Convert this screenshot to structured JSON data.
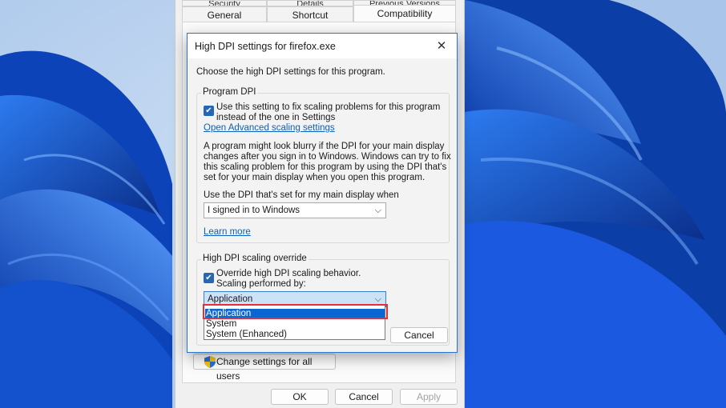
{
  "properties": {
    "tabs_top": [
      "Security",
      "Details",
      "Previous Versions"
    ],
    "tabs": [
      "General",
      "Shortcut",
      "Compatibility"
    ],
    "active_tab": "Compatibility",
    "change_settings_label": "Change settings for all users",
    "ok_label": "OK",
    "cancel_label": "Cancel",
    "apply_label": "Apply"
  },
  "dpi_dialog": {
    "title": "High DPI settings for firefox.exe",
    "intro": "Choose the high DPI settings for this program.",
    "program_dpi": {
      "group_label": "Program DPI",
      "checkbox_checked": true,
      "checkbox_line1": "Use this setting to fix scaling problems for this program",
      "checkbox_line2": "instead of the one in Settings",
      "link_advanced": "Open Advanced scaling settings",
      "description_lines": [
        "A program might look blurry if the DPI for your main display",
        "changes after you sign in to Windows. Windows can try to fix",
        "this scaling problem for this program by using the DPI that's",
        "set for your main display when you open this program."
      ],
      "select_label": "Use the DPI that's set for my main display when",
      "select_value": "I signed in to Windows",
      "link_learn": "Learn more"
    },
    "override": {
      "group_label": "High DPI scaling override",
      "checkbox_checked": true,
      "checkbox_line1": "Override high DPI scaling behavior.",
      "checkbox_line2": "Scaling performed by:",
      "select_value": "Application",
      "options": [
        "Application",
        "System",
        "System (Enhanced)"
      ],
      "selected_option": "Application"
    },
    "cancel_label": "Cancel",
    "close_glyph": "✕"
  },
  "colors": {
    "accent": "#2667b5",
    "selection": "#0b66d0",
    "highlight_box": "#e0303a",
    "link": "#0a60c0"
  },
  "icons": {
    "close": "close-icon",
    "checkbox": "checkmark-icon",
    "dropdown": "chevron-down-icon",
    "uac": "uac-shield-icon"
  }
}
